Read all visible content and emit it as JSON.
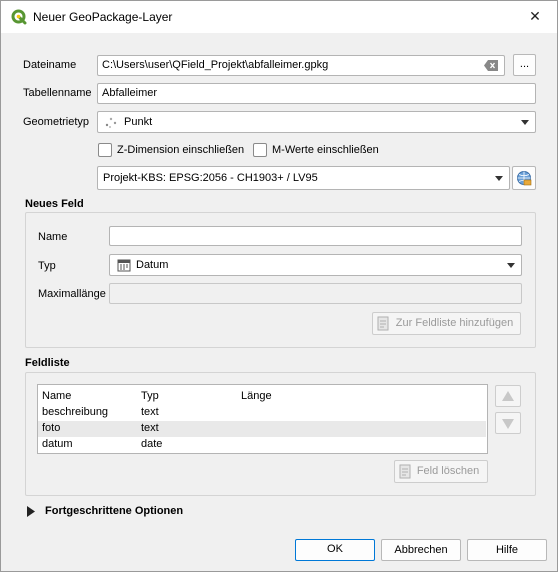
{
  "window": {
    "title": "Neuer GeoPackage-Layer",
    "close_glyph": "✕",
    "app_icon": "qgis-logo-icon"
  },
  "form": {
    "filename_label": "Dateiname",
    "filename_value": "C:\\Users\\user\\QField_Projekt\\abfalleimer.gpkg",
    "browse_label": "...",
    "tablename_label": "Tabellenname",
    "tablename_value": "Abfalleimer",
    "geomtype_label": "Geometrietyp",
    "geomtype_value": "Punkt",
    "z_dimension_label": "Z-Dimension einschließen",
    "m_values_label": "M-Werte einschließen",
    "crs_value": "Projekt-KBS: EPSG:2056 - CH1903+ / LV95"
  },
  "new_field": {
    "section_title": "Neues Feld",
    "name_label": "Name",
    "name_value": "",
    "type_label": "Typ",
    "type_value": "Datum",
    "maxlen_label": "Maximallänge",
    "add_button": "Zur Feldliste hinzufügen"
  },
  "field_list": {
    "section_title": "Feldliste",
    "columns": [
      "Name",
      "Typ",
      "Länge"
    ],
    "rows": [
      {
        "name": "beschreibung",
        "type": "text",
        "length": ""
      },
      {
        "name": "foto",
        "type": "text",
        "length": ""
      },
      {
        "name": "datum",
        "type": "date",
        "length": ""
      }
    ],
    "delete_button": "Feld löschen"
  },
  "advanced": {
    "label": "Fortgeschrittene Optionen"
  },
  "footer": {
    "ok": "OK",
    "cancel": "Abbrechen",
    "help": "Hilfe"
  },
  "colors": {
    "accent": "#0078d7",
    "qgis_green": "#589632",
    "alt_row": "#e9e9e9"
  }
}
